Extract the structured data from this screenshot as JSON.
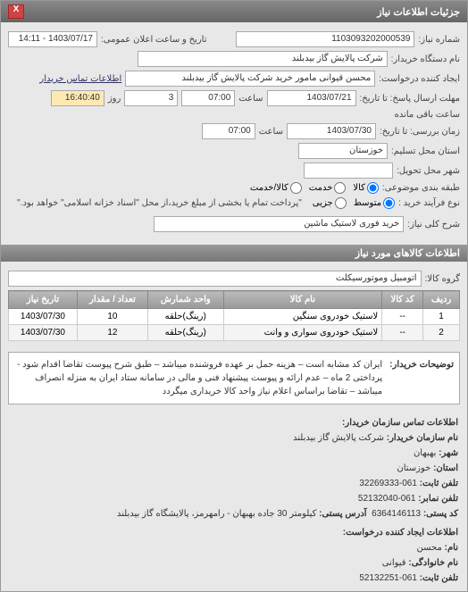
{
  "panel": {
    "title": "جزئیات اطلاعات نیاز",
    "close": "X"
  },
  "header": {
    "req_no_label": "شماره نیاز:",
    "req_no": "1103093202000539",
    "announce_label": "تاریخ و ساعت اعلان عمومی:",
    "announce": "1403/07/17 - 14:11",
    "buyer_name_label": "نام دستگاه خریدار:",
    "buyer_name": "شرکت پالایش گاز بیدبلند",
    "requester_label": "ایجاد کننده درخواست:",
    "requester": "محسن قیوانی مامور خرید شرکت پالایش گاز بیدبلند",
    "buyer_contact_label": "اطلاعات تماس خریدار",
    "deadline_to_label": "مهلت ارسال پاسخ: تا تاریخ:",
    "deadline_date": "1403/07/21",
    "deadline_time_label": "ساعت",
    "deadline_time": "07:00",
    "days_label": "روز",
    "days": "3",
    "remain_label": "ساعت باقی مانده",
    "remain": "16:40:40",
    "review_to_label": "زمان بررسی: تا تاریخ:",
    "review_date": "1403/07/30",
    "review_time_label": "ساعت",
    "review_time": "07:00",
    "province_label": "استان محل تسلیم:",
    "province": "خوزستان",
    "city_label": "شهر محل تحویل:",
    "category_label": "طبقه بندی موضوعی:",
    "cat_goods": "کالا",
    "cat_service": "خدمت",
    "cat_both": "کالا/خدمت",
    "process_label": "نوع فرآیند خرید :",
    "proc_medium": "متوسط",
    "proc_partial": "جزیی",
    "payment_note": "\"پرداخت تمام یا بخشی از مبلغ خرید،از محل \"اسناد خزانه اسلامی\" خواهد بود.\"",
    "need_title_label": "شرح کلی نیاز:",
    "need_title": "خرید فوری لاستیک ماشین"
  },
  "goods": {
    "section_title": "اطلاعات کالاهای مورد نیاز",
    "group_label": "گروه کالا:",
    "group": "اتومبیل وموتورسیکلت",
    "cols": {
      "row": "ردیف",
      "code": "کد کالا",
      "name": "نام کالا",
      "unit": "واحد شمارش",
      "qty": "تعداد / مقدار",
      "date": "تاریخ نیاز"
    },
    "rows": [
      {
        "idx": "1",
        "code": "--",
        "name": "لاستیک خودروی سنگین",
        "unit": "(رینگ)حلقه",
        "qty": "10",
        "date": "1403/07/30"
      },
      {
        "idx": "2",
        "code": "--",
        "name": "لاستیک خودروی سواری و وانت",
        "unit": "(رینگ)حلقه",
        "qty": "12",
        "date": "1403/07/30"
      }
    ]
  },
  "desc": {
    "label": "توضیحات خریدار:",
    "text": "ایران کد مشابه است – هزینه حمل بر عهده فروشنده میباشد – طبق شرح پیوست تقاضا اقدام شود - پرداختی 2 ماه – عدم ارائه و پیوست پیشنهاد فنی و مالی در سامانه ستاد ایران به منزله انصراف میباشد – تقاضا براساس اعلام نیاز واحد کالا خریداری میگردد"
  },
  "contacts": {
    "section_title": "اطلاعات تماس سازمان خریدار:",
    "org_label": "نام سازمان خریدار:",
    "org": "شرکت پالایش گاز بیدبلند",
    "city_label": "شهر:",
    "city": "بهبهان",
    "province_label": "استان:",
    "province": "خوزستان",
    "phone_label": "تلفن ثابت:",
    "phone": "061-32269333",
    "fax_label": "تلفن نمابر:",
    "fax": "061-52132040",
    "postcode_label": "کد پستی:",
    "postcode": "6364146113",
    "address_label": "آدرس پستی:",
    "address": "کیلومتر 30 جاده بهبهان - رامهرمز، پالایشگاه گاز بیدبلند",
    "req_section": "اطلاعات ایجاد کننده درخواست:",
    "fname_label": "نام:",
    "fname": "محسن",
    "lname_label": "نام خانوادگی:",
    "lname": "قیوانی",
    "rphone_label": "تلفن ثابت:",
    "rphone": "061-52132251"
  }
}
